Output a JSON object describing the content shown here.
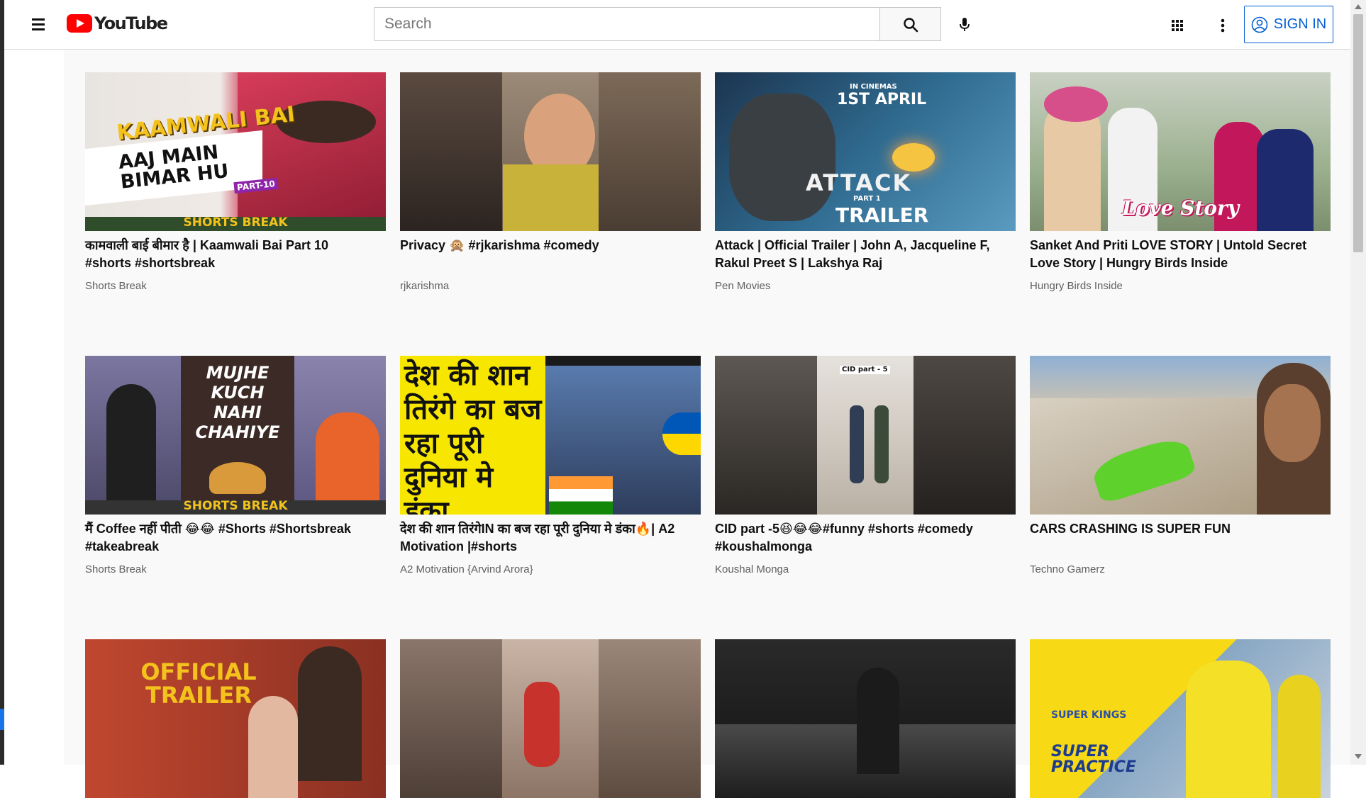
{
  "header": {
    "logo_text": "YouTube",
    "search_placeholder": "Search",
    "sign_in_label": "SIGN IN"
  },
  "icons": {
    "menu": "menu-icon",
    "search": "search-icon",
    "mic": "microphone-icon",
    "apps": "apps-grid-icon",
    "more": "more-vertical-icon",
    "account": "account-circle-icon"
  },
  "colors": {
    "brand_red": "#ff0000",
    "link_blue": "#065fd4",
    "channel_gray": "#606060"
  },
  "videos": [
    {
      "title": "कामवाली बाई बीमार है | Kaamwali Bai Part 10 #shorts #shortsbreak",
      "channel": "Shorts Break",
      "thumb_text": [
        "KAAMWALI BAI",
        "AAJ MAIN BIMAR HU",
        "PART-10",
        "SHORTS BREAK"
      ]
    },
    {
      "title": "Privacy 🙊 #rjkarishma #comedy",
      "channel": "rjkarishma",
      "thumb_text": []
    },
    {
      "title": "Attack | Official Trailer | John A, Jacqueline F, Rakul Preet S | Lakshya Raj",
      "channel": "Pen Movies",
      "thumb_text": [
        "IN CINEMAS",
        "1ST APRIL",
        "ATTACK",
        "PART 1",
        "TRAILER"
      ]
    },
    {
      "title": "Sanket And Priti LOVE STORY | Untold Secret Love Story | Hungry Birds Inside",
      "channel": "Hungry Birds Inside",
      "thumb_text": [
        "Love Story"
      ]
    },
    {
      "title": "मैं Coffee नहीं पीती 😂😂 #Shorts #Shortsbreak #takeabreak",
      "channel": "Shorts Break",
      "thumb_text": [
        "MUJHE KUCH NAHI CHAHIYE",
        "SHORTS BREAK"
      ]
    },
    {
      "title": "देश की शान तिरंगेIN का बज रहा पूरी दुनिया मे डंका🔥| A2 Motivation |#shorts",
      "channel": "A2 Motivation {Arvind Arora}",
      "thumb_text": [
        "देश की शान तिरंगे का बज रहा पूरी दुनिया मे डंका"
      ]
    },
    {
      "title": "CID part -5😆😂😂#funny #shorts #comedy #koushalmonga",
      "channel": "Koushal Monga",
      "thumb_text": [
        "CID part - 5"
      ]
    },
    {
      "title": "CARS CRASHING IS SUPER FUN",
      "channel": "Techno Gamerz",
      "thumb_text": []
    },
    {
      "title": "",
      "channel": "",
      "thumb_text": [
        "OFFICIAL TRAILER"
      ]
    },
    {
      "title": "",
      "channel": "",
      "thumb_text": []
    },
    {
      "title": "",
      "channel": "",
      "thumb_text": []
    },
    {
      "title": "",
      "channel": "",
      "thumb_text": [
        "SUPER KINGS",
        "SUPER PRACTICE"
      ]
    }
  ]
}
